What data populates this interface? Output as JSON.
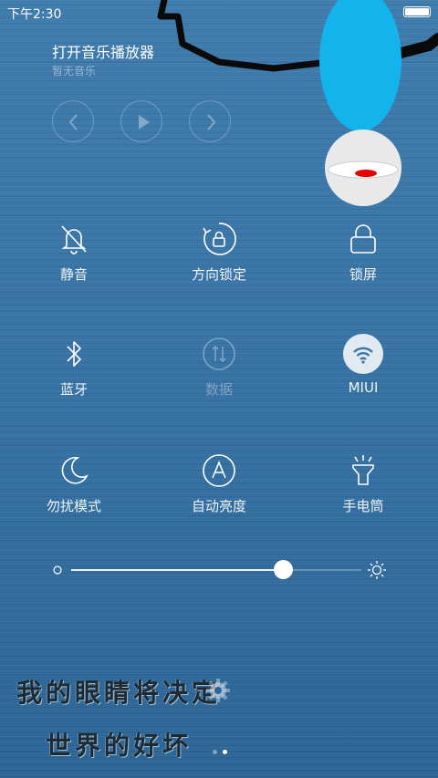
{
  "status_bar": {
    "time": "下午2:30",
    "battery_level": 1.0
  },
  "music": {
    "title": "打开音乐播放器",
    "subtitle": "暂无音乐",
    "controls": [
      "previous-icon",
      "play-icon",
      "next-icon"
    ]
  },
  "toggles": [
    {
      "label": "静音",
      "icon": "bell-off-icon",
      "active": false
    },
    {
      "label": "方向锁定",
      "icon": "rotation-lock-icon",
      "active": false
    },
    {
      "label": "锁屏",
      "icon": "lock-icon",
      "active": false
    },
    {
      "label": "蓝牙",
      "icon": "bluetooth-icon",
      "active": false
    },
    {
      "label": "数据",
      "icon": "mobile-data-icon",
      "active": false,
      "disabled": true
    },
    {
      "label": "MIUI",
      "icon": "wifi-icon",
      "active": true
    },
    {
      "label": "勿扰模式",
      "icon": "moon-icon",
      "active": false
    },
    {
      "label": "自动亮度",
      "icon": "auto-brightness-icon",
      "active": false
    },
    {
      "label": "手电筒",
      "icon": "flashlight-icon",
      "active": false
    }
  ],
  "brightness": {
    "value": 0.72,
    "min_icon": "dim-icon",
    "max_icon": "sun-icon"
  },
  "wallpaper_text": {
    "line1": "我的眼睛将决定",
    "line2": "世界的好坏"
  },
  "pager": {
    "count": 2,
    "active": 1
  },
  "colors": {
    "background": "#3a76a8",
    "cartoon_blue": "#13b3ec",
    "accent_red": "#e30000"
  }
}
